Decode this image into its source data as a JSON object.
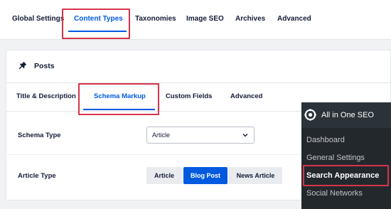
{
  "top_nav": {
    "items": [
      {
        "label": "Global Settings"
      },
      {
        "label": "Content Types",
        "active": true
      },
      {
        "label": "Taxonomies"
      },
      {
        "label": "Image SEO"
      },
      {
        "label": "Archives"
      },
      {
        "label": "Advanced"
      }
    ]
  },
  "card": {
    "title": "Posts",
    "icon": "pin-icon",
    "tabs": [
      {
        "label": "Title & Description"
      },
      {
        "label": "Schema Markup",
        "active": true
      },
      {
        "label": "Custom Fields"
      },
      {
        "label": "Advanced"
      }
    ],
    "schema_type": {
      "label": "Schema Type",
      "value": "Article"
    },
    "article_type": {
      "label": "Article Type",
      "options": [
        "Article",
        "Blog Post",
        "News Article"
      ],
      "selected": "Blog Post"
    }
  },
  "wp_menu": {
    "title": "All in One SEO",
    "items": [
      "Dashboard",
      "General Settings",
      "Search Appearance",
      "Social Networks"
    ],
    "current": "Search Appearance"
  },
  "colors": {
    "accent": "#005ae0",
    "highlight_box": "#d6344a",
    "wp_menu_bg": "#23282d"
  }
}
